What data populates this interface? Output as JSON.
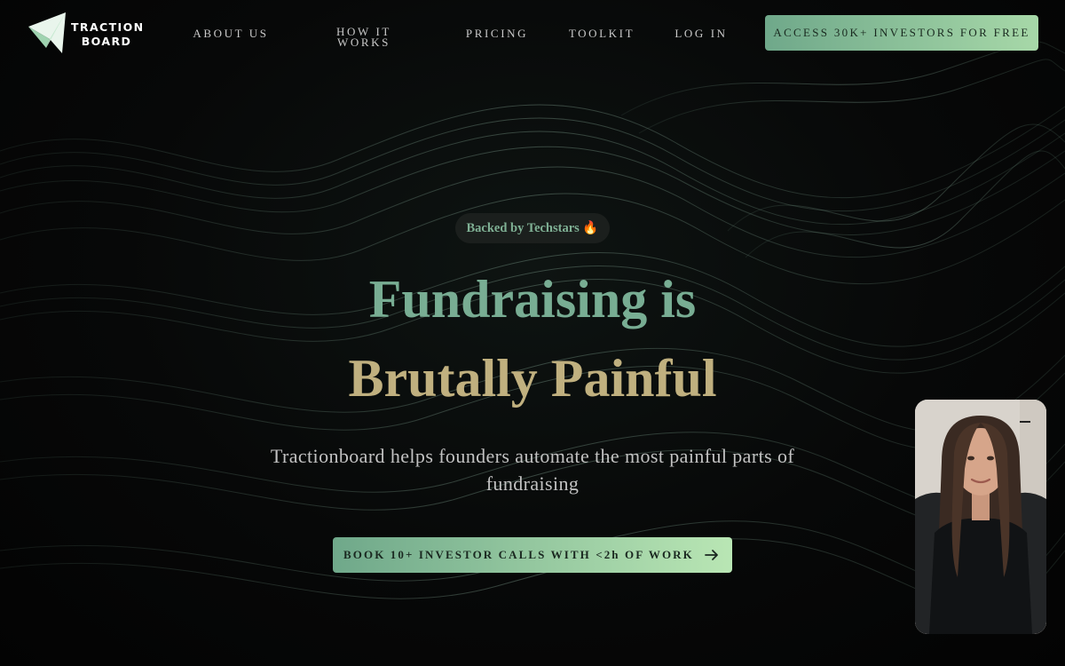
{
  "brand": {
    "name_line1": "TRACTION",
    "name_line2": "BOARD",
    "accent_green": "#78ad93",
    "accent_gold": "#c0b07f"
  },
  "nav": {
    "about": "ABOUT US",
    "how_line1": "HOW IT",
    "how_line2": "WORKS",
    "pricing": "PRICING",
    "toolkit": "TOOLKIT",
    "login": "LOG IN",
    "cta": "ACCESS 30K+ INVESTORS FOR FREE"
  },
  "hero": {
    "badge": "Backed by Techstars 🔥",
    "title_line1": "Fundraising is",
    "title_line2": "Brutally Painful",
    "subtitle": "Tractionboard helps founders automate the most painful parts of fundraising",
    "cta": "BOOK 10+ INVESTOR CALLS WITH <2h OF WORK",
    "cta_icon": "arrow-right-icon"
  },
  "video_widget": {
    "icon": "minimize-icon"
  }
}
